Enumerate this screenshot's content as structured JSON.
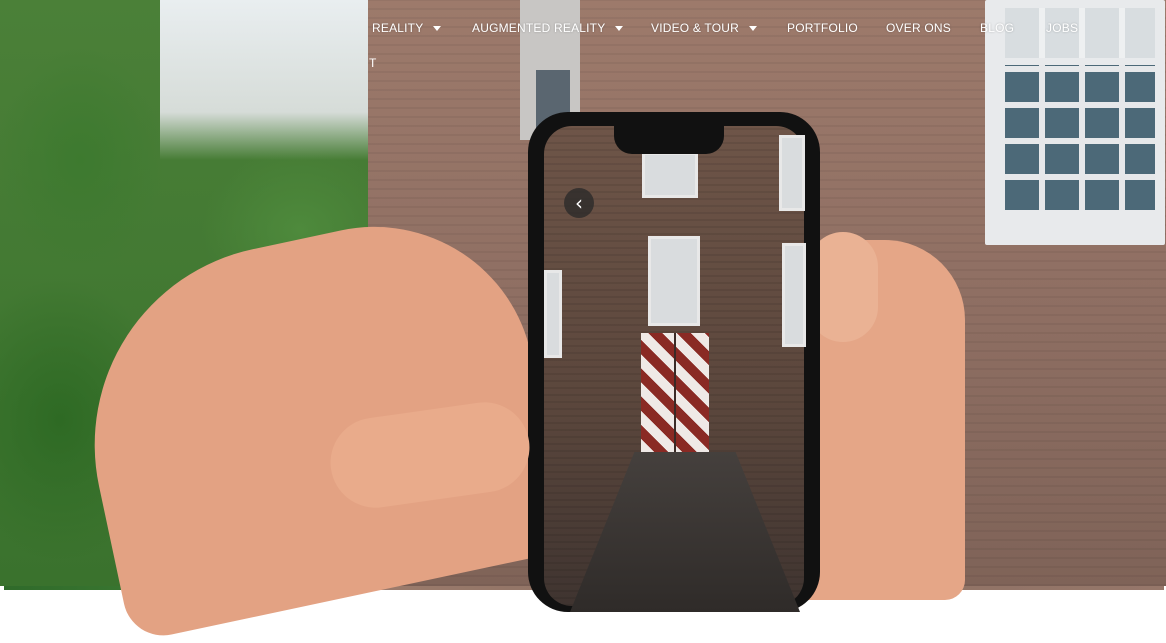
{
  "nav": {
    "items": [
      {
        "label": "REALITY",
        "dropdown": true
      },
      {
        "label": "AUGMENTED REALITY",
        "dropdown": true
      },
      {
        "label": "VIDEO & TOUR",
        "dropdown": true
      },
      {
        "label": "PORTFOLIO",
        "dropdown": false
      },
      {
        "label": "OVER ONS",
        "dropdown": false
      },
      {
        "label": "BLOG",
        "dropdown": false
      },
      {
        "label": "JOBS",
        "dropdown": false
      }
    ],
    "overflow_fragment": "T"
  },
  "hero": {
    "image_subject": "hands-holding-phone-showing-castle-gate-in-ar",
    "back_icon": "chevron-left-icon"
  },
  "colors": {
    "nav_text": "#ffffff",
    "phone_body": "#111111",
    "door_red": "#8a2a24",
    "door_white": "#efe9e6"
  }
}
